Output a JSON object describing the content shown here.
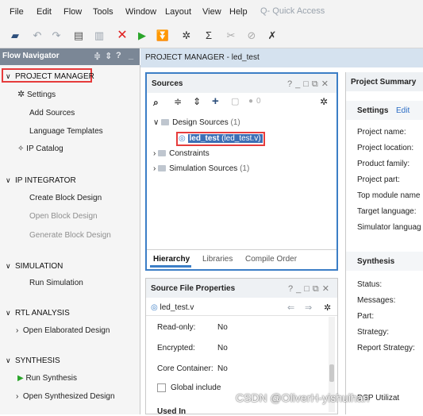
{
  "menubar": {
    "items": [
      "File",
      "Edit",
      "Flow",
      "Tools",
      "Window",
      "Layout",
      "View",
      "Help"
    ],
    "quick_access": "Q- Quick Access"
  },
  "toolbar": {
    "icons": [
      "open-project-icon",
      "undo-icon",
      "redo-icon",
      "copy-icon",
      "paste-icon",
      "delete-icon",
      "run-icon",
      "step-icon",
      "settings-icon",
      "sigma-icon",
      "tool-icon",
      "pencil-icon",
      "cancel-icon"
    ]
  },
  "flow_navigator": {
    "title": "Flow Navigator",
    "sections": [
      {
        "label": "PROJECT MANAGER",
        "items": [
          "Settings",
          "Add Sources",
          "Language Templates",
          "IP Catalog"
        ]
      },
      {
        "label": "IP INTEGRATOR",
        "items": [
          "Create Block Design",
          "Open Block Design",
          "Generate Block Design"
        ]
      },
      {
        "label": "SIMULATION",
        "items": [
          "Run Simulation"
        ]
      },
      {
        "label": "RTL ANALYSIS",
        "items": [
          "Open Elaborated Design"
        ]
      },
      {
        "label": "SYNTHESIS",
        "items": [
          "Run Synthesis",
          "Open Synthesized Design"
        ]
      }
    ]
  },
  "project_manager_header": "PROJECT MANAGER - led_test",
  "sources": {
    "title": "Sources",
    "badge": "0",
    "tree": {
      "design_sources": "Design Sources",
      "design_sources_count": "(1)",
      "top_module": "led_test",
      "top_module_file": "(led_test.v)",
      "constraints": "Constraints",
      "simulation_sources": "Simulation Sources",
      "simulation_sources_count": "(1)"
    },
    "tabs": [
      "Hierarchy",
      "Libraries",
      "Compile Order"
    ]
  },
  "source_file_properties": {
    "title": "Source File Properties",
    "file": "led_test.v",
    "rows": [
      {
        "label": "Read-only:",
        "value": "No"
      },
      {
        "label": "Encrypted:",
        "value": "No"
      },
      {
        "label": "Core Container:",
        "value": "No"
      }
    ],
    "global_include": "Global include",
    "used_in": "Used In"
  },
  "project_summary": {
    "title": "Project Summary",
    "settings": "Settings",
    "edit": "Edit",
    "fields": [
      "Project name:",
      "Project location:",
      "Product family:",
      "Project part:",
      "Top module name",
      "Target language:",
      "Simulator languag"
    ],
    "synthesis": "Synthesis",
    "synth_fields": [
      "Status:",
      "Messages:",
      "Part:",
      "Strategy:",
      "Report Strategy:"
    ],
    "dsp_label": "DSP Utilizat"
  },
  "watermark": "CSDN @OliverH-yishuihan"
}
